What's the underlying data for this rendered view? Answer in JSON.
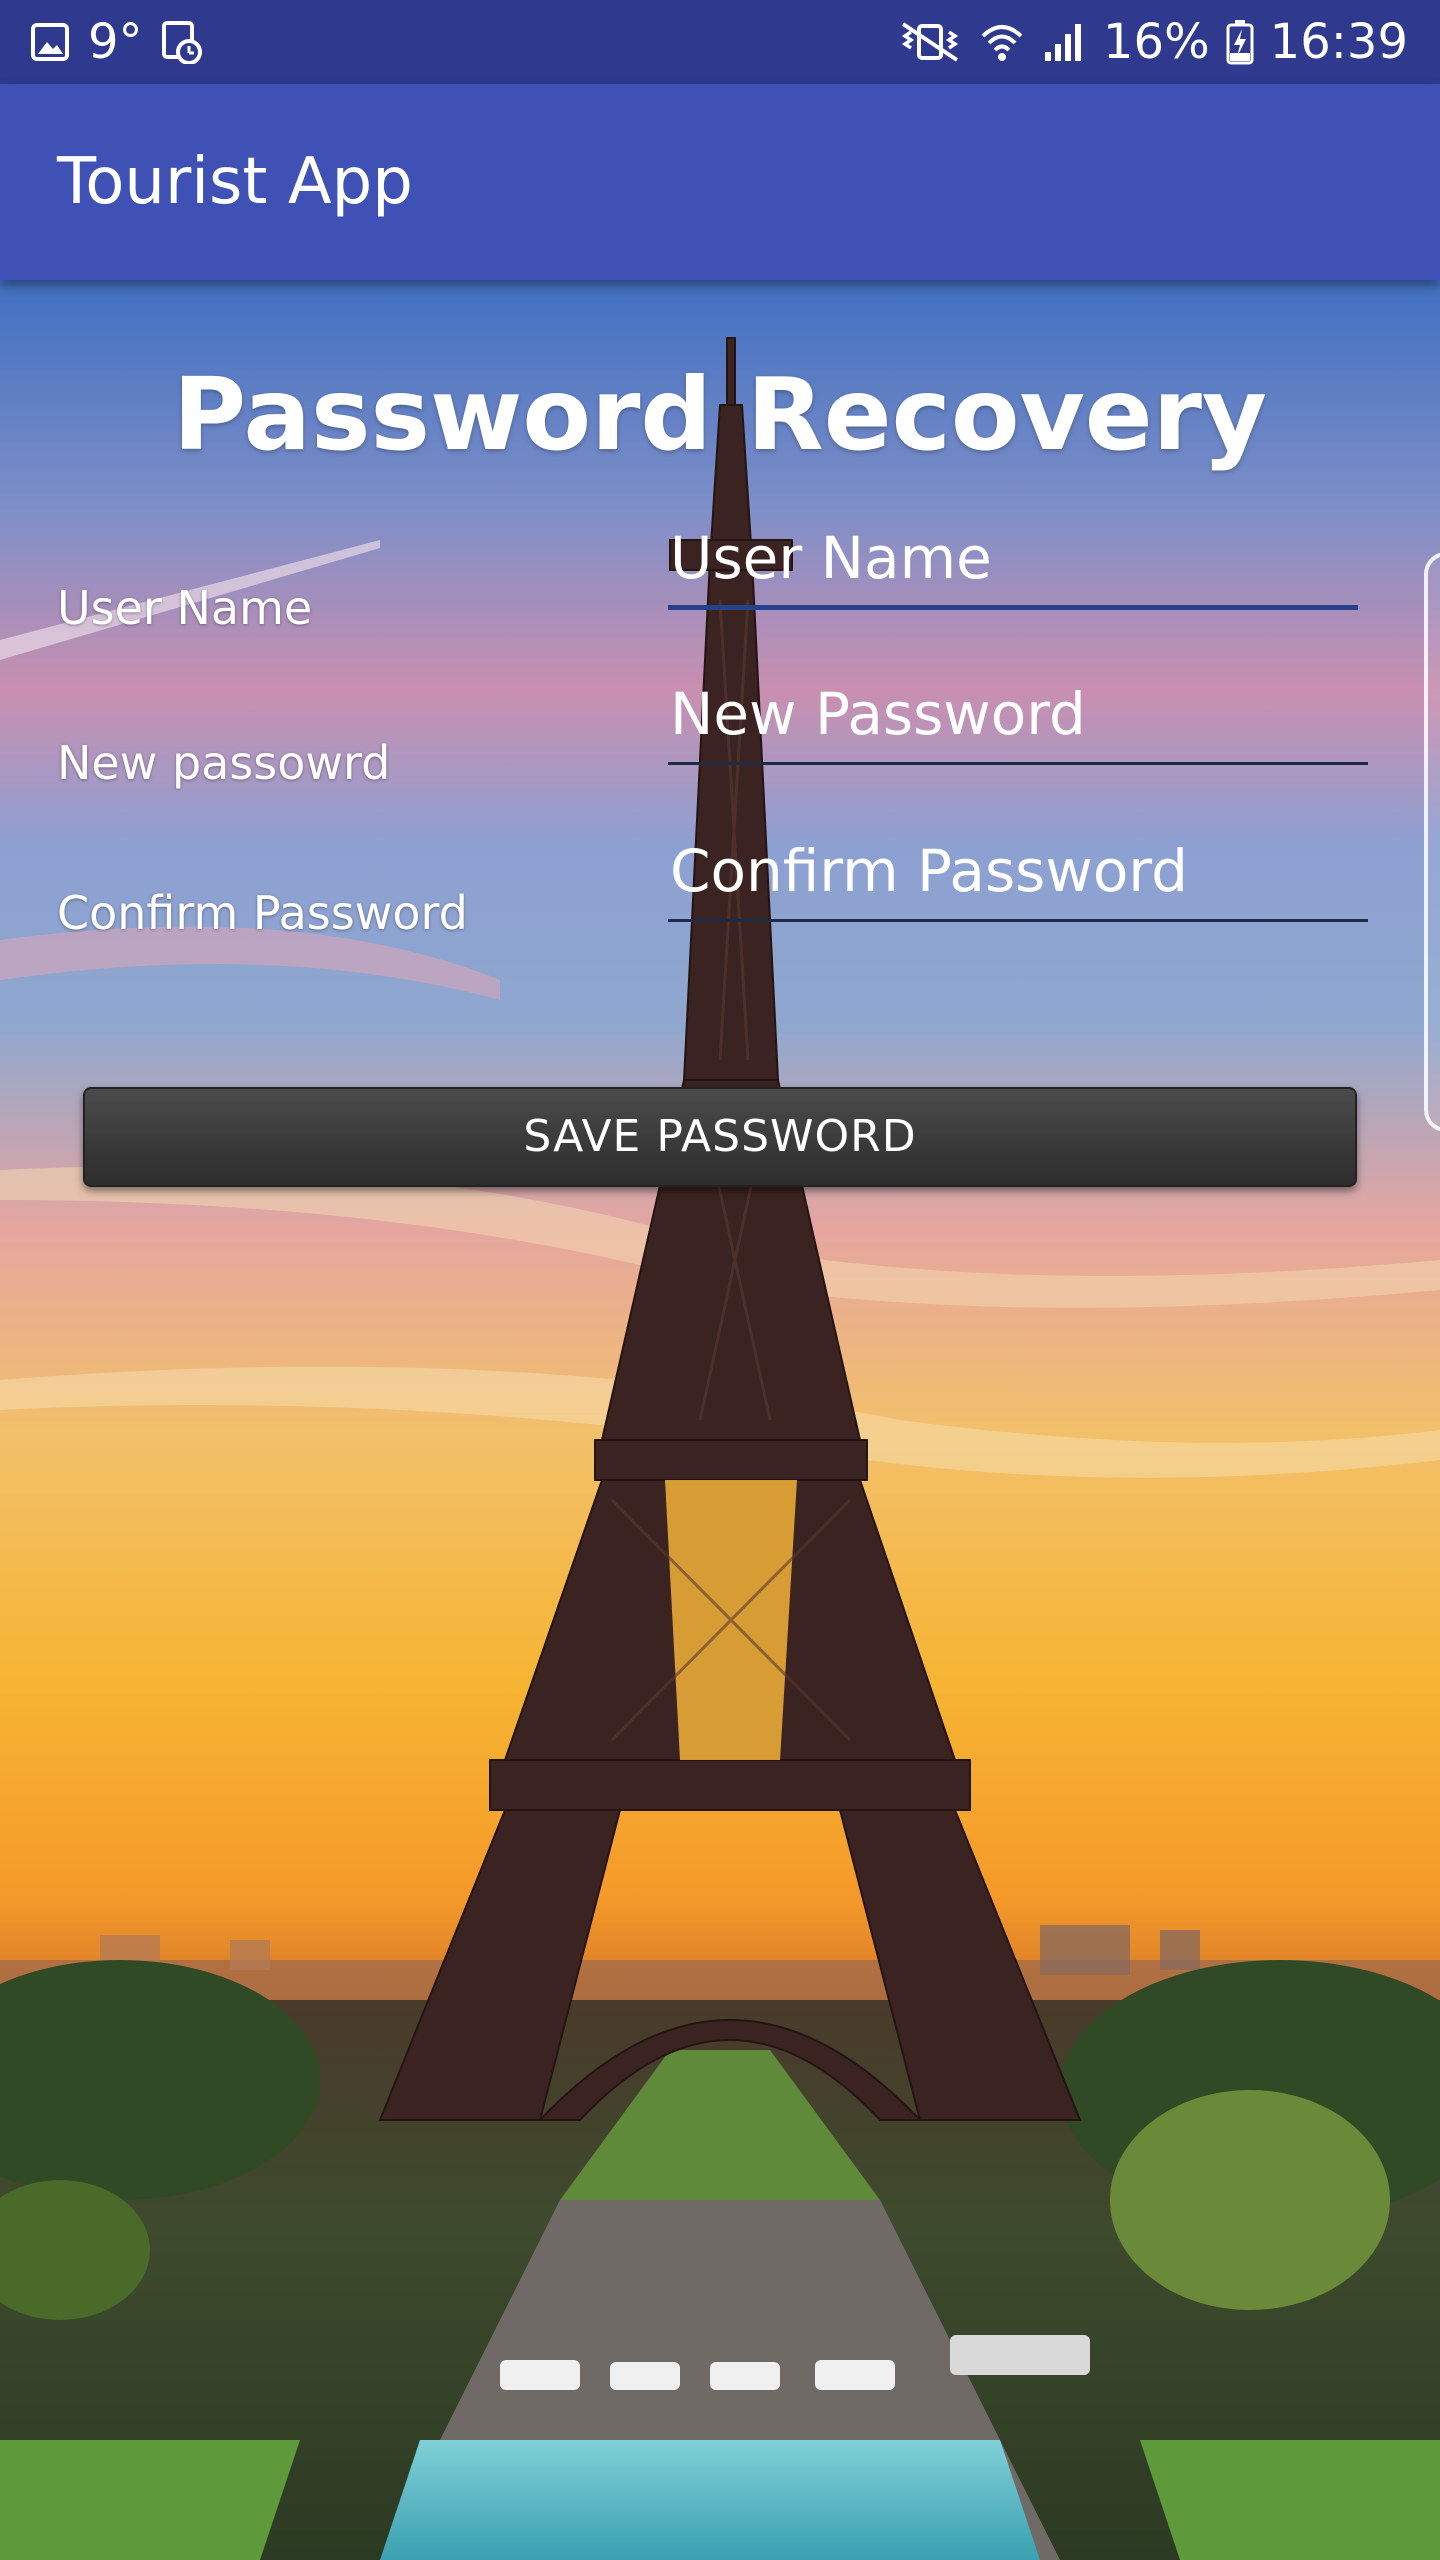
{
  "status_bar": {
    "temperature": "9°",
    "battery_percent": "16%",
    "time": "16:39",
    "icons_left": [
      "gallery-icon",
      "clock-document-icon"
    ],
    "icons_right": [
      "vibrate-mute-icon",
      "wifi-icon",
      "cell-signal-icon",
      "battery-charging-icon"
    ]
  },
  "app_bar": {
    "title": "Tourist App",
    "color": "#3f51b5",
    "status_color": "#2f3a8f"
  },
  "form": {
    "heading": "Password Recovery",
    "labels": {
      "user_name": "User Name",
      "new_password": "New passowrd",
      "confirm_password": "Confirm Password"
    },
    "inputs": {
      "user_name": {
        "placeholder": "User Name",
        "value": ""
      },
      "new_password": {
        "placeholder": "New Password",
        "value": ""
      },
      "confirm_password": {
        "placeholder": "Confirm Password",
        "value": ""
      }
    },
    "save_button": "SAVE PASSWORD"
  },
  "background": {
    "subject": "eiffel-tower-sunset-photo",
    "sky_top": "#2a4fa8",
    "sky_mid": "#d98aa0",
    "sky_glow": "#f5b23a",
    "tower_color": "#3a2320"
  }
}
